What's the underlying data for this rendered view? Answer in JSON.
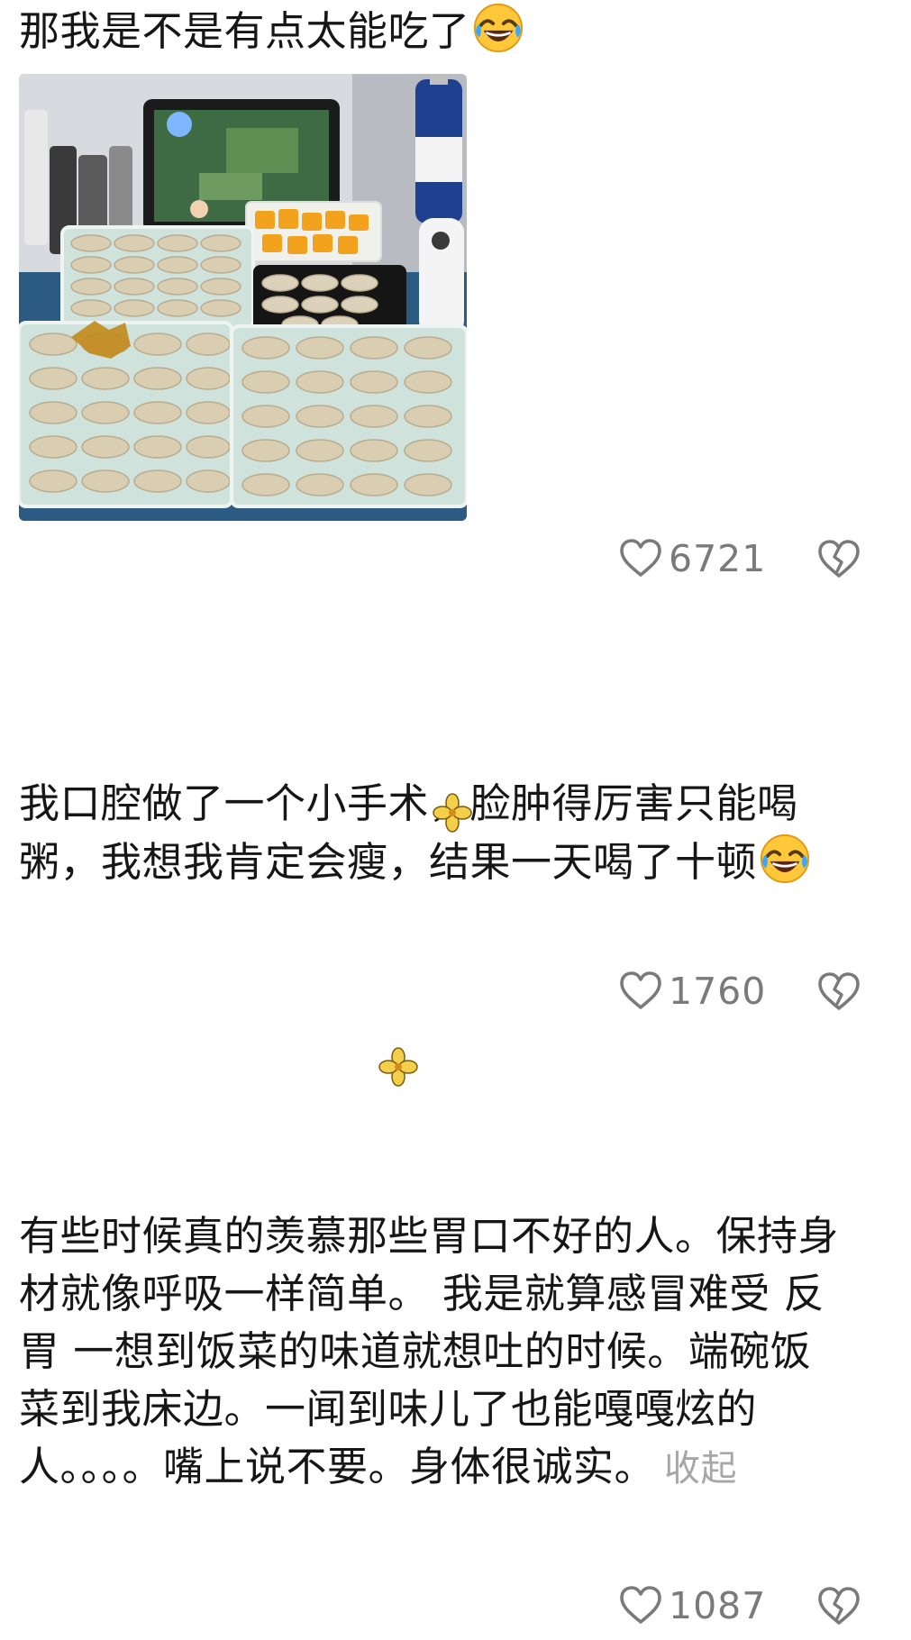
{
  "comments": [
    {
      "text": "那我是不是有点太能吃了",
      "emoji": "rolling-on-floor-laughing-emoji",
      "like_count": "6721"
    },
    {
      "text": "我口腔做了一个小手术，脸肿得厉害只能喝粥，我想我肯定会瘦，结果一天喝了十顿",
      "emoji": "rolling-on-floor-laughing-emoji",
      "like_count": "1760"
    },
    {
      "text": "有些时候真的羡慕那些胃口不好的人。保持身材就像呼吸一样简单。 我是就算感冒难受 反胃 一想到饭菜的味道就想吐的时候。端碗饭菜到我床边。一闻到味儿了也能嘎嘎炫的人。。。。嘴上说不要。身体很诚实。",
      "collapse_label": "收起",
      "like_count": "1087"
    }
  ],
  "icons": {
    "like": "heart-outline-icon",
    "dislike": "broken-heart-icon",
    "sticker": "yellow-flower-sticker"
  },
  "colors": {
    "text": "#161616",
    "muted": "#7a7a7a",
    "collapse": "#a7a7a7",
    "tray": "#cfe3dc",
    "dumpling": "#d9cdb2",
    "mango": "#f2a21c"
  }
}
